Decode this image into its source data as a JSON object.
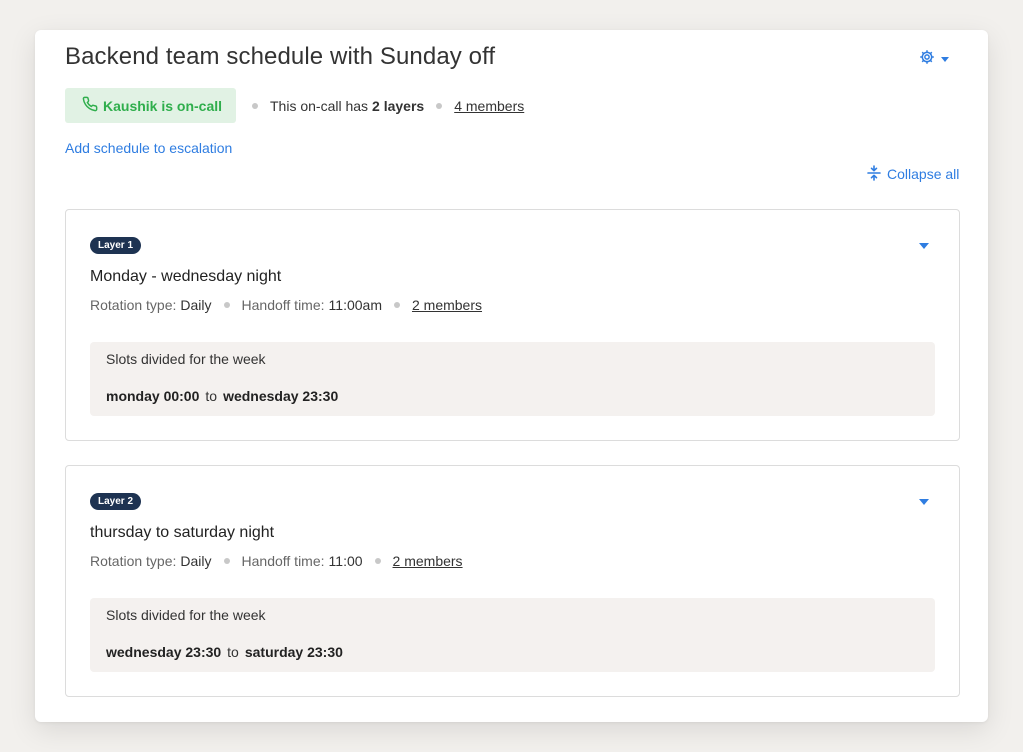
{
  "schedule": {
    "title": "Backend team schedule with Sunday off",
    "oncall_label": "Kaushik is on-call",
    "meta_prefix": "This on-call has",
    "layers_count": "2 layers",
    "members_link": "4 members",
    "add_escalation": "Add schedule to escalation",
    "collapse_all": "Collapse all"
  },
  "layers": [
    {
      "badge": "Layer 1",
      "title": "Monday - wednesday night",
      "rotation_label": "Rotation type:",
      "rotation_value": "Daily",
      "handoff_label": "Handoff time:",
      "handoff_value": "11:00am",
      "members": "2 members",
      "slots_title": "Slots divided for the week",
      "from": "monday 00:00",
      "to_word": "to",
      "to": "wednesday 23:30"
    },
    {
      "badge": "Layer 2",
      "title": "thursday to saturday night",
      "rotation_label": "Rotation type:",
      "rotation_value": "Daily",
      "handoff_label": "Handoff time:",
      "handoff_value": "11:00",
      "members": "2 members",
      "slots_title": "Slots divided for the week",
      "from": "wednesday 23:30",
      "to_word": "to",
      "to": "saturday 23:30"
    }
  ],
  "icons": {
    "settings": "gear-icon",
    "phone": "phone-icon",
    "collapse": "collapse-icon",
    "expand": "chevron-down-icon"
  },
  "colors": {
    "accent": "#2f7de1",
    "oncall_green": "#2fae4c",
    "oncall_bg": "#e1f2e4",
    "badge_bg": "#1e3352"
  }
}
